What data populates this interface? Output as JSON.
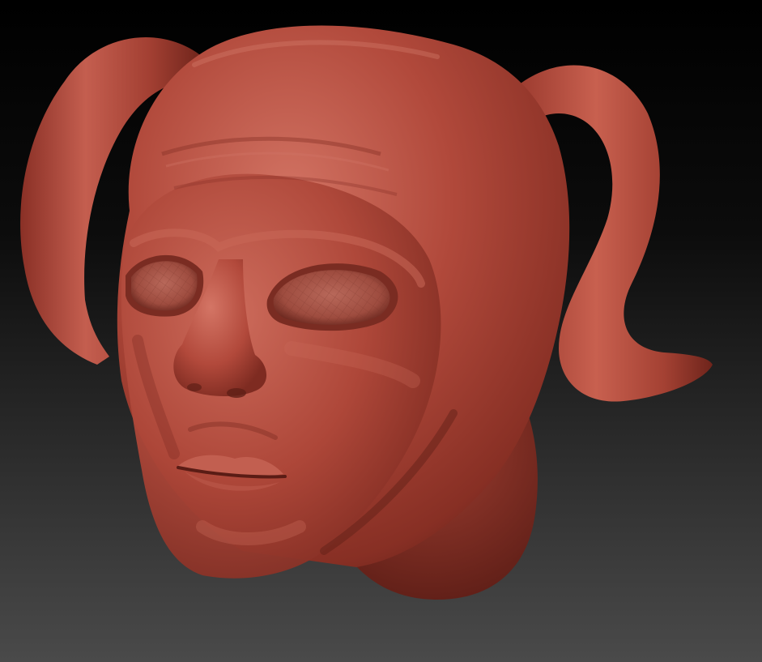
{
  "viewport": {
    "background_top": "#000000",
    "background_bottom": "#4a4a4a"
  },
  "model": {
    "clay_color": "#b04a3c",
    "clay_highlight": "#d37364",
    "clay_shadow": "#5c1d16",
    "socket_color": "#a9574a"
  }
}
